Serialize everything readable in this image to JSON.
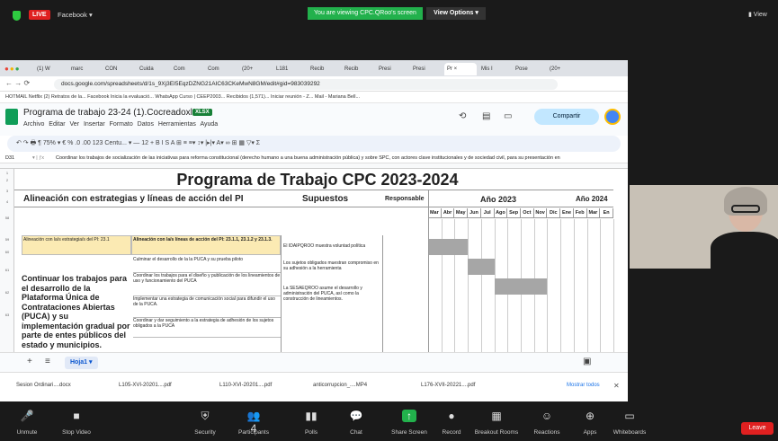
{
  "zoom_top": {
    "live": "LIVE",
    "meeting": "Facebook ▾",
    "viewing": "You are viewing CPC.QRoo's screen",
    "view_options": "View Options ▾",
    "view_right": "▮ View"
  },
  "browser": {
    "tabs": [
      "(1) W",
      "marc",
      "CON",
      "Cuida",
      "Com",
      "Com",
      "(20+",
      "L181",
      "Recib",
      "Recib",
      "Presi",
      "Presi",
      "Pr ×",
      "Mis I",
      "Pose",
      "(20+"
    ],
    "url": "docs.google.com/spreadsheets/d/1s_9Xj3EI5EqzDZNG21AIC63CKeMwN8GM/edit#gid=983039292",
    "bookmarks": "HOTMAIL   Netflix   (2) Retratos de la...   Facebook   Inicia la evaluació...   WhatsApp   Curso | CEEP2003...   Recibidos (1,571)...   Iniciar reunión - Z...   Mail - Mariana Bell..."
  },
  "doc": {
    "title": "Programa de trabajo 23-24 (1).Cocreadoxlsx",
    "badge": "XLSX",
    "menu": "Archivo  Editar  Ver  Insertar  Formato  Datos  Herramientas  Ayuda",
    "share": "Compartir",
    "toolbar": "↶  ↷  🖶  ¶  75%  ▾  €  %  .0  .00  123   Centu... ▾  —  12  +   B  I  S  A   ⊞  ≡  ≡▾  ↕▾  |▸|▾  A▾   ∞  ⊞  ▦  ▽▾  Σ",
    "cell_ref": "D31",
    "formula": "Coordinar los trabajos de socialización de las iniciativas para reforma constitucional (derecho humano a una buena administración pública) y sobre SPC, con actores clave institucionales y de sociedad civil, para su presentación en"
  },
  "sheet": {
    "title": "Programa de Trabajo CPC 2023-2024",
    "col_alineacion": "Alineación con estrategias y líneas de acción del PI",
    "col_supuestos": "Supuestos",
    "col_responsable": "Responsable",
    "year1": "Año 2023",
    "year2": "Año 2024",
    "months": [
      "Mar",
      "Abr",
      "May",
      "Jun",
      "Jul",
      "Ago",
      "Sep",
      "Oct",
      "Nov",
      "Dic",
      "Ene",
      "Feb",
      "Mar",
      "En"
    ],
    "row_header_left": "Alineación con la/s estrategia/s del PI: 23.1",
    "row_header_mid": "Alineación con la/s líneas de acción del PI: 23.1.1, 23.1.2 y 23.1.3.",
    "big_text": "Continuar los trabajos para el desarrollo de la Plataforma Única de Contrataciones Abiertas (PUCA) y su implementación gradual por parte de entes públicos del estado y municipios.",
    "activities": [
      "Culminar el desarrollo de la la PUCA y su prueba piloto",
      "Coordinar los trabajos para el diseño y publicación de los lineamientos de uso y funcionamiento del PUCA",
      "Implementar una estrategia de comunicación social para difundir el uso de la PUCA.",
      "Coordinar y dar seguimiento a la estrategia de adhesión de los sujetos obligados a la PUCA"
    ],
    "supuestos": [
      "El IDAIPQROO muestra voluntad política",
      "Los sujetos obligados muestran compromiso en su adhesión a la herramienta",
      "La SESAEQROO asume el desarrollo y administración del PUCA, así como la construcción de lineamientos."
    ],
    "sheet_tab": "Hoja1 ▾"
  },
  "downloads": [
    "Sesion Ordinari....docx",
    "L105-XVI-20201....pdf",
    "L110-XVI-20201....pdf",
    "anticorrupcion_....MP4",
    "L176-XVII-20221....pdf"
  ],
  "mostrar": "Mostrar todos",
  "zoom_bottom": [
    {
      "label": "Unmute",
      "icon": "🎤"
    },
    {
      "label": "Stop Video",
      "icon": "■"
    },
    {
      "label": "Security",
      "icon": "⛨"
    },
    {
      "label": "Participants",
      "icon": "👥 4"
    },
    {
      "label": "Polls",
      "icon": "▮▮"
    },
    {
      "label": "Chat",
      "icon": "💬"
    },
    {
      "label": "Share Screen",
      "icon": "↑"
    },
    {
      "label": "Record",
      "icon": "●"
    },
    {
      "label": "Breakout Rooms",
      "icon": "▦"
    },
    {
      "label": "Reactions",
      "icon": "☺"
    },
    {
      "label": "Apps",
      "icon": "⊕"
    },
    {
      "label": "Whiteboards",
      "icon": "▭"
    }
  ],
  "leave": "Leave"
}
